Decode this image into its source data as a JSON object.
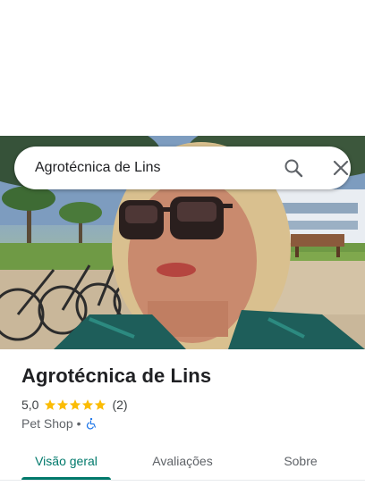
{
  "search": {
    "value": "Agrotécnica de Lins",
    "search_icon": "search-icon",
    "close_icon": "close-icon"
  },
  "place": {
    "photo_icon": "place-photo",
    "name": "Agrotécnica de Lins",
    "rating": "5,0",
    "stars": 5,
    "review_count": "(2)",
    "category": "Pet Shop",
    "separator": "•",
    "accessibility_icon": "wheelchair-icon"
  },
  "tabs": [
    {
      "label": "Visão geral",
      "active": true
    },
    {
      "label": "Avaliações",
      "active": false
    },
    {
      "label": "Sobre",
      "active": false
    }
  ],
  "colors": {
    "accent": "#00796b",
    "star": "#fbbc04",
    "accessibility": "#1a73e8"
  }
}
